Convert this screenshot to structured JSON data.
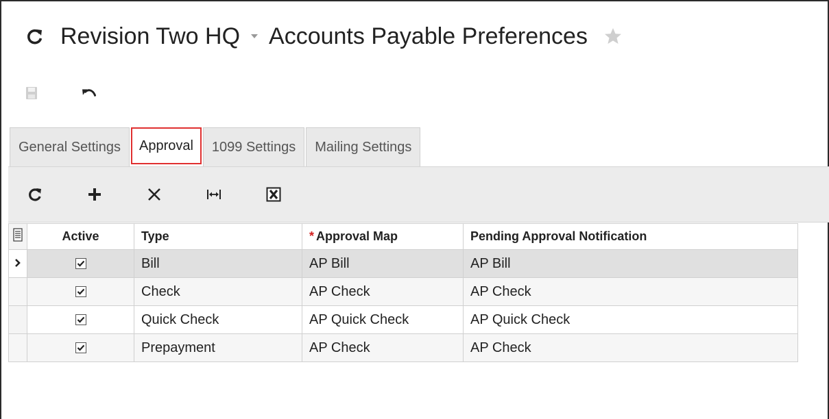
{
  "header": {
    "company": "Revision Two HQ",
    "screen_title": "Accounts Payable Preferences"
  },
  "tabs": [
    {
      "label": "General Settings"
    },
    {
      "label": "Approval"
    },
    {
      "label": "1099 Settings"
    },
    {
      "label": "Mailing Settings"
    }
  ],
  "grid": {
    "columns": {
      "active": "Active",
      "type": "Type",
      "approval_map_required": "*",
      "approval_map": "Approval Map",
      "pending_notification": "Pending Approval Notification"
    },
    "rows": [
      {
        "active": true,
        "type": "Bill",
        "approval_map": "AP Bill",
        "notification": "AP Bill"
      },
      {
        "active": true,
        "type": "Check",
        "approval_map": "AP Check",
        "notification": "AP Check"
      },
      {
        "active": true,
        "type": "Quick Check",
        "approval_map": "AP Quick Check",
        "notification": "AP Quick Check"
      },
      {
        "active": true,
        "type": "Prepayment",
        "approval_map": "AP Check",
        "notification": "AP Check"
      }
    ]
  },
  "icons": {
    "title_refresh": "refresh-icon",
    "title_dropdown": "caret-down-icon",
    "favorite": "star-icon",
    "save": "save-icon",
    "undo": "undo-icon",
    "grid_refresh": "refresh-icon",
    "add": "plus-icon",
    "delete": "close-icon",
    "fit_columns": "fit-width-icon",
    "export": "excel-export-icon",
    "row_selector": "chevron-right-icon",
    "column_chooser": "column-settings-icon"
  },
  "colors": {
    "tab_highlight": "#e03030",
    "required_marker": "#d32020",
    "selected_row": "#e0e0e0"
  }
}
